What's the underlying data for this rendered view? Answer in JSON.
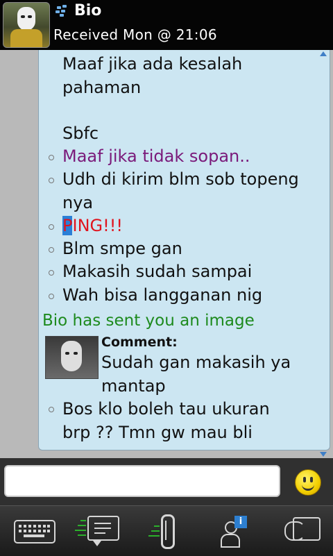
{
  "header": {
    "contact_name": "Bio",
    "status": "Received Mon @ 21:06"
  },
  "messages": [
    {
      "text": "Maaf jika ada kesalah",
      "style": "normal"
    },
    {
      "text": "pahaman",
      "style": "normal"
    },
    {
      "text": "Sbfc",
      "style": "normal"
    },
    {
      "text": "Maaf jika tidak sopan..",
      "style": "purple"
    },
    {
      "text": "Udh di kirim blm sob topeng",
      "style": "normal"
    },
    {
      "text": "nya",
      "style": "normal"
    },
    {
      "ping_first": "P",
      "ping_rest": "ING!!!",
      "style": "red"
    },
    {
      "text": "Blm smpe gan",
      "style": "normal"
    },
    {
      "text": "Makasih sudah sampai",
      "style": "normal"
    },
    {
      "text": "Wah bisa langganan nig",
      "style": "normal"
    },
    {
      "text": "Bio has sent you an image",
      "style": "green"
    },
    {
      "comment_label": "Comment:",
      "comment_line1": "Sudah gan makasih ya",
      "comment_line2": "mantap"
    },
    {
      "text": "Bos klo boleh tau ukuran",
      "style": "normal"
    },
    {
      "text": "brp ?? Tmn gw mau bli",
      "style": "normal"
    }
  ],
  "input": {
    "value": "",
    "placeholder": ""
  },
  "toolbar": {
    "items": [
      "keyboard-icon",
      "messages-icon",
      "attachment-icon",
      "contact-info-icon",
      "switch-chat-icon"
    ],
    "info_badge": "i"
  },
  "colors": {
    "chat_bg": "#cce6f2",
    "purple": "#7a1a7a",
    "red": "#e0141e",
    "green": "#1d8a1d",
    "highlight": "#2a7fd6"
  }
}
